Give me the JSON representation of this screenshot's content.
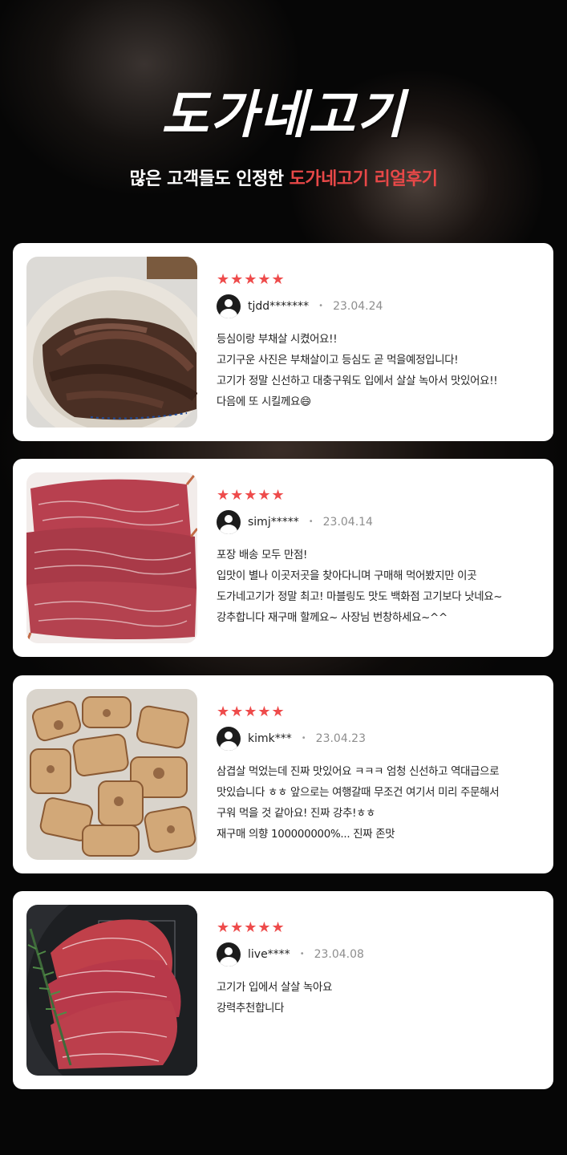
{
  "header": {
    "logo": "도가네고기",
    "subtitle_prefix": "많은 고객들도 인정한 ",
    "subtitle_accent": "도가네고기 리얼후기"
  },
  "colors": {
    "accent": "#e84848",
    "star": "#ee4b4b",
    "background": "#060606",
    "card": "#ffffff"
  },
  "reviews": [
    {
      "rating": 5,
      "stars": "★★★★★",
      "user": "tjdd*******",
      "date": "23.04.24",
      "photo_icon": "grilled-beef-photo",
      "lines": [
        "등심이랑 부채살 시켰어요!!",
        "고기구운 사진은 부채살이고 등심도 곧 먹을예정입니다!",
        "고기가 정말 신선하고 대충구워도 입에서 살살 녹아서 맛있어요!!",
        "다음에 또 시킬께요😄"
      ]
    },
    {
      "rating": 5,
      "stars": "★★★★★",
      "user": "simj*****",
      "date": "23.04.14",
      "photo_icon": "raw-marbled-beef-photo",
      "lines": [
        "포장 배송 모두 만점!",
        "입맛이 별나 이곳저곳을 찾아다니며 구매해 먹어봤지만 이곳",
        "도가네고기가 정말 최고! 마블링도 맛도 백화점 고기보다 낫네요~",
        "강추합니다 재구매 할께요~ 사장님 번창하세요~^^"
      ]
    },
    {
      "rating": 5,
      "stars": "★★★★★",
      "user": "kimk***",
      "date": "23.04.23",
      "photo_icon": "grilled-pork-belly-photo",
      "lines": [
        "삼겹살 먹었는데 진짜 맛있어요 ㅋㅋㅋ 엄청 신선하고 역대급으로",
        "맛있습니다 ㅎㅎ 앞으로는 여행갈때 무조건 여기서 미리 주문해서",
        "구워 먹을 것 같아요! 진짜 강추!ㅎㅎ",
        "재구매 의향 100000000%... 진짜 존맛"
      ]
    },
    {
      "rating": 5,
      "stars": "★★★★★",
      "user": "live****",
      "date": "23.04.08",
      "photo_icon": "sliced-wagyu-plate-photo",
      "lines": [
        "고기가 입에서 살살 녹아요",
        "강력추천합니다"
      ]
    }
  ]
}
